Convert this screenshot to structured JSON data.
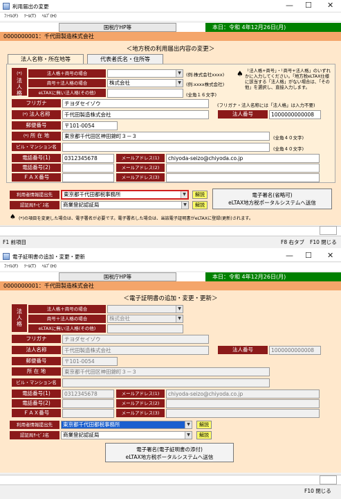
{
  "w1": {
    "title": "利用届出の変更",
    "menu": [
      "ﾌｧｲﾙ(F)",
      "ﾂｰﾙ(T)",
      "ﾍﾙﾌﾟ(H)"
    ],
    "hp_button": "国税庁HP等",
    "date": "本日：令和 4年12月26日(月)",
    "org": "0000000001：千代田製造株式会社",
    "heading": "＜地方税の利用届出内容の変更＞",
    "tabs": [
      "法人名称・所在地等",
      "代表者氏名・住所等"
    ],
    "corp_kind_label": "法人格",
    "corp_kind_mark": "(*)",
    "rows": {
      "kaku_shogo_label": "法人格＋商号の場合",
      "kaku_shogo_value": "",
      "kaku_shogo_note": "(例:株式会社xxxx)",
      "shogo_kaku_label": "商号＋法人格の場合",
      "shogo_kaku_value": "株式会社",
      "shogo_kaku_note": "(例:xxxx株式会社)",
      "eltax_label": "eLTAXに無い法人格(その他)",
      "eltax_value": "",
      "eltax_note": "(全角１６文字)",
      "furigana_label": "フリガナ",
      "furigana_value": "チヨダセイゾウ",
      "furigana_note": "(フリガナ・法人名称には「法人格」は入力不要)",
      "name_mark": "(*)",
      "name_label": "法人名称",
      "name_value": "千代田製造株式会社",
      "corpno_label": "法人番号",
      "corpno_value": "1000000000008",
      "zip_label": "郵便番号",
      "zip_value": "〒101-0054",
      "addr_mark": "(*)",
      "addr_label": "所 在 地",
      "addr_value": "東京都千代田区神田錦町３－３",
      "addr_note": "(全角４０文字)",
      "bldg_label": "ビル・マンション名",
      "bldg_value": "",
      "bldg_note": "(全角４０文字)",
      "tel1_label": "電話番号(1)",
      "tel1_value": "0312345678",
      "tel2_label": "電話番号(2)",
      "tel2_value": "",
      "fax_label": "ＦＡＸ番号",
      "fax_value": "",
      "mail1_label": "メールアドレス(1)",
      "mail1_value": "chiyoda-seizo@chiyoda.co.jp",
      "mail2_label": "メールアドレス(2)",
      "mail2_value": "",
      "mail3_label": "メールアドレス(3)",
      "mail3_value": ""
    },
    "info_note": "「法人格+商号」・「商号+法人格」のいずれかに入力してください。「地方税eLTAX仕様に該当する「法人格」がない場合は、「その他」を選択し、直接入力します。",
    "submit_label": "利用者情報提出先",
    "submit_value": "東京都千代田都税事務所",
    "auth_label": "認証局ｻｰﾋﾞｽ名",
    "auth_value": "商業登記認証局",
    "kaisetsu": "解説",
    "sign_button_line1": "電子署名(省略可)",
    "sign_button_line2": "eLTAX地方税ポータルシステムへ送信",
    "footer_note": "(*)の項目を変更した場合は、電子署名が必要です。電子署名した場合は、当該電子証明書がeLTAXに登録(更新)されます。",
    "fkeys": {
      "f1": "F1 前項目",
      "f8": "F8 右タブ",
      "f10": "F10 閉じる"
    }
  },
  "w2": {
    "title": "電子証明書の追加・変更・更新",
    "menu": [
      "ﾌｧｲﾙ(F)",
      "ﾂｰﾙ(T)",
      "ﾍﾙﾌﾟ(H)"
    ],
    "hp_button": "国税庁HP等",
    "date": "本日：令和 4年12月26日(月)",
    "org": "0000000001：千代田製造株式会社",
    "heading": "＜電子証明書の追加・変更・更新＞",
    "corp_kind_label": "法人格",
    "rows": {
      "kaku_shogo_label": "法人格＋商号の場合",
      "kaku_shogo_value": "",
      "shogo_kaku_label": "商号＋法人格の場合",
      "shogo_kaku_value": "株式会社",
      "eltax_label": "eLTAXに無い法人格(その他)",
      "eltax_value": "",
      "furigana_label": "フリガナ",
      "furigana_value": "チヨダセイゾウ",
      "name_label": "法人名称",
      "name_value": "千代田製造株式会社",
      "corpno_label": "法人番号",
      "corpno_value": "1000000000008",
      "zip_label": "郵便番号",
      "zip_value": "〒101-0054",
      "addr_label": "所 在 地",
      "addr_value": "東京都千代田区神田錦町３－３",
      "bldg_label": "ビル・マンション名",
      "bldg_value": "",
      "tel1_label": "電話番号(1)",
      "tel1_value": "0312345678",
      "tel2_label": "電話番号(2)",
      "tel2_value": "",
      "fax_label": "ＦＡＸ番号",
      "fax_value": "",
      "mail1_label": "メールアドレス(1)",
      "mail1_value": "chiyoda-seizo@chiyoda.co.jp",
      "mail2_label": "メールアドレス(2)",
      "mail2_value": "",
      "mail3_label": "メールアドレス(3)",
      "mail3_value": ""
    },
    "submit_label": "利用者情報提出先",
    "submit_value": "東京都千代田都税事務所",
    "auth_label": "認証局ｻｰﾋﾞｽ名",
    "auth_value": "商業登記認証局",
    "kaisetsu": "解説",
    "sign_button_line1": "電子署名(電子証明書の添付)",
    "sign_button_line2": "eLTAX地方税ポータルシステムへ送信",
    "fkeys": {
      "f10": "F10 閉じる"
    }
  },
  "colors": {
    "label_bg": "#8b1a1a",
    "panel_bg": "#ffe8cc",
    "org_bar": "#f4a56a",
    "date_bg": "#008000",
    "kaisetsu_bg": "#ffff66"
  }
}
